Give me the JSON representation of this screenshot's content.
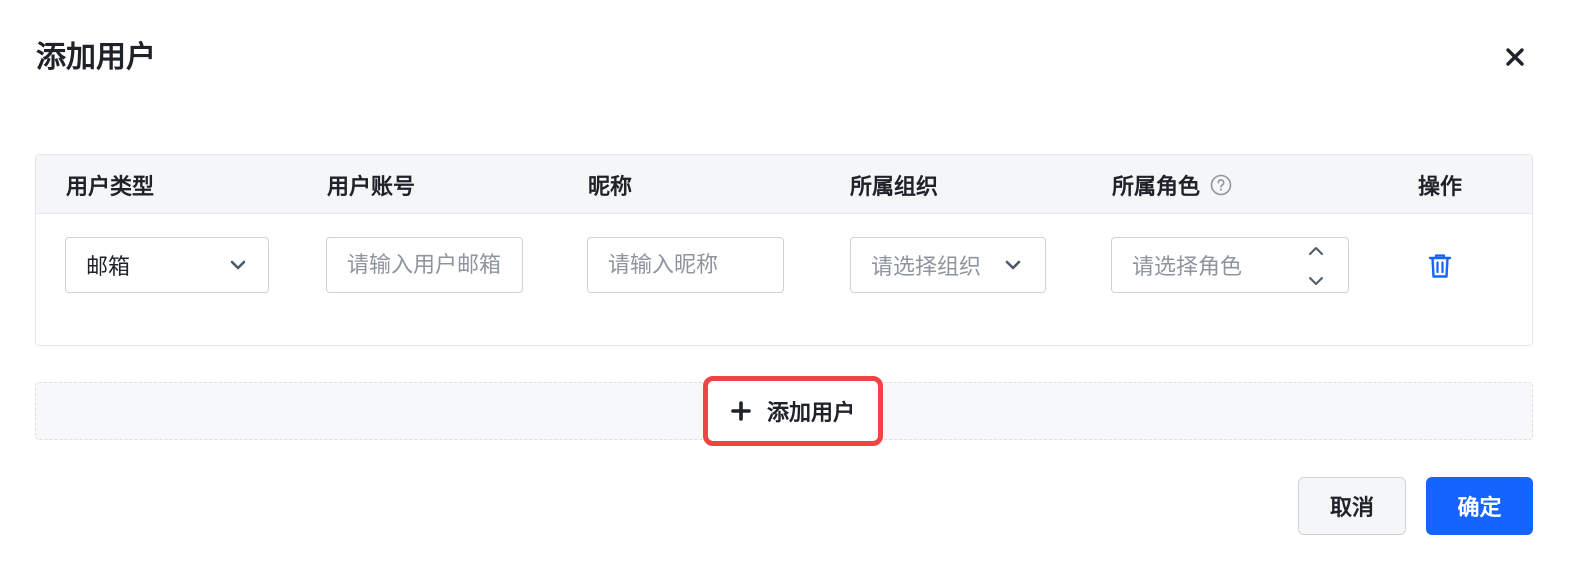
{
  "dialog": {
    "title": "添加用户",
    "close_icon": "close-icon"
  },
  "table": {
    "columns": [
      {
        "label": "用户类型"
      },
      {
        "label": "用户账号"
      },
      {
        "label": "昵称"
      },
      {
        "label": "所属组织"
      },
      {
        "label": "所属角色",
        "help_icon": "question-circle-icon"
      },
      {
        "label": "操作"
      }
    ],
    "rows": [
      {
        "user_type": {
          "value": "邮箱",
          "icon": "chevron-down-icon"
        },
        "account": {
          "placeholder": "请输入用户邮箱"
        },
        "nickname": {
          "placeholder": "请输入昵称"
        },
        "organization": {
          "placeholder": "请选择组织",
          "icon": "chevron-down-icon"
        },
        "role": {
          "placeholder": "请选择角色",
          "icon": "chevron-up-down-icon"
        },
        "action": {
          "icon": "trash-icon"
        }
      }
    ]
  },
  "add_user": {
    "label": "添加用户",
    "icon": "plus-icon"
  },
  "footer": {
    "cancel_label": "取消",
    "confirm_label": "确定"
  },
  "colors": {
    "primary": "#1664ff",
    "highlight": "#ef4444",
    "header_bg": "#f5f6f7",
    "border": "#e5e6eb"
  }
}
